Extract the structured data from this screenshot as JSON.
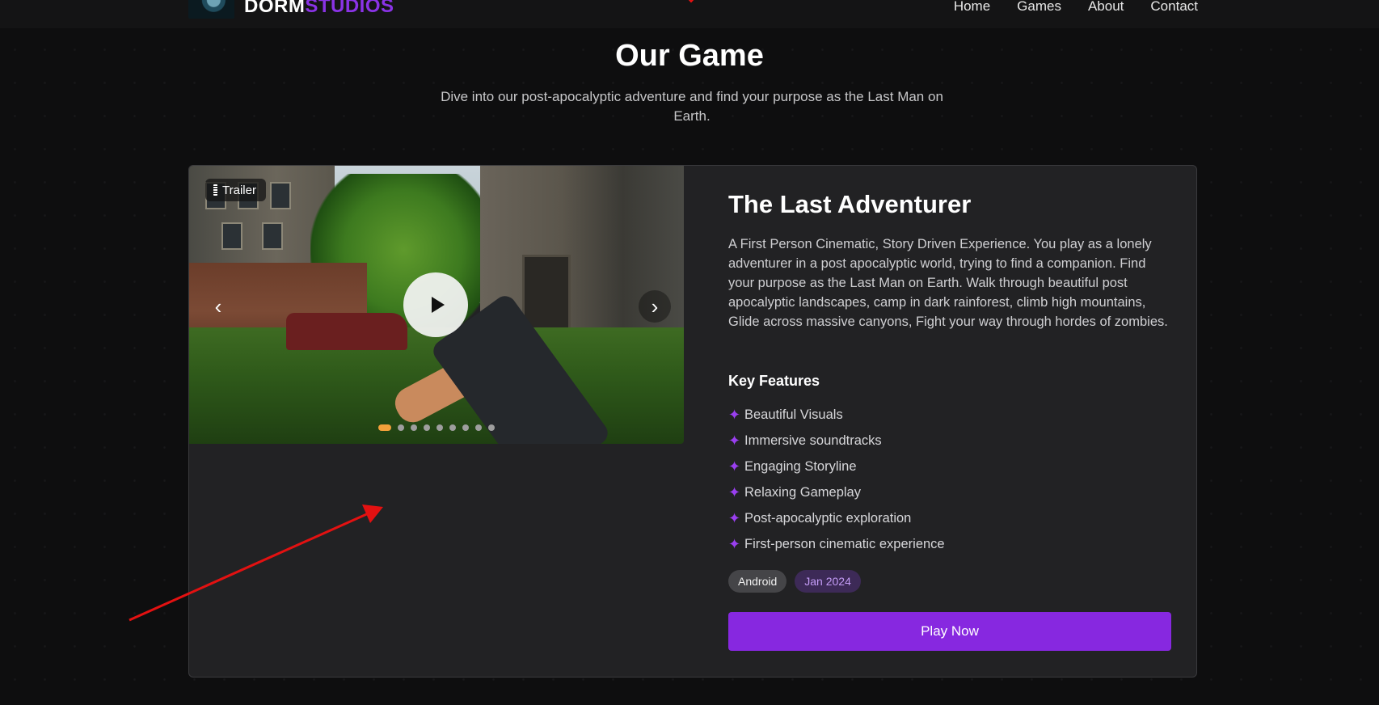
{
  "header": {
    "logo_primary": "DORM",
    "logo_accent": "STUDIOS",
    "nav": [
      "Home",
      "Games",
      "About",
      "Contact"
    ]
  },
  "section": {
    "title": "Our Game",
    "subtitle": "Dive into our post-apocalyptic adventure and find your purpose as the Last Man on Earth."
  },
  "game": {
    "badge": "Trailer",
    "title": "The Last Adventurer",
    "description": "A First Person Cinematic, Story Driven Experience. You play as a lonely adventurer in a post apocalyptic world, trying to find a companion. Find your purpose as the Last Man on Earth. Walk through beautiful post apocalyptic landscapes, camp in dark rainforest, climb high mountains, Glide across massive canyons, Fight your way through hordes of zombies.",
    "features_title": "Key Features",
    "features": [
      "Beautiful Visuals",
      "Immersive soundtracks",
      "Engaging Storyline",
      "Relaxing Gameplay",
      "Post-apocalyptic exploration",
      "First-person cinematic experience"
    ],
    "platform": "Android",
    "release": "Jan 2024",
    "cta": "Play Now",
    "carousel": {
      "slides": 9,
      "active_index": 0
    }
  },
  "colors": {
    "accent": "#8728e0",
    "active_dot": "#f2a03b",
    "annotation": "#e31111"
  }
}
